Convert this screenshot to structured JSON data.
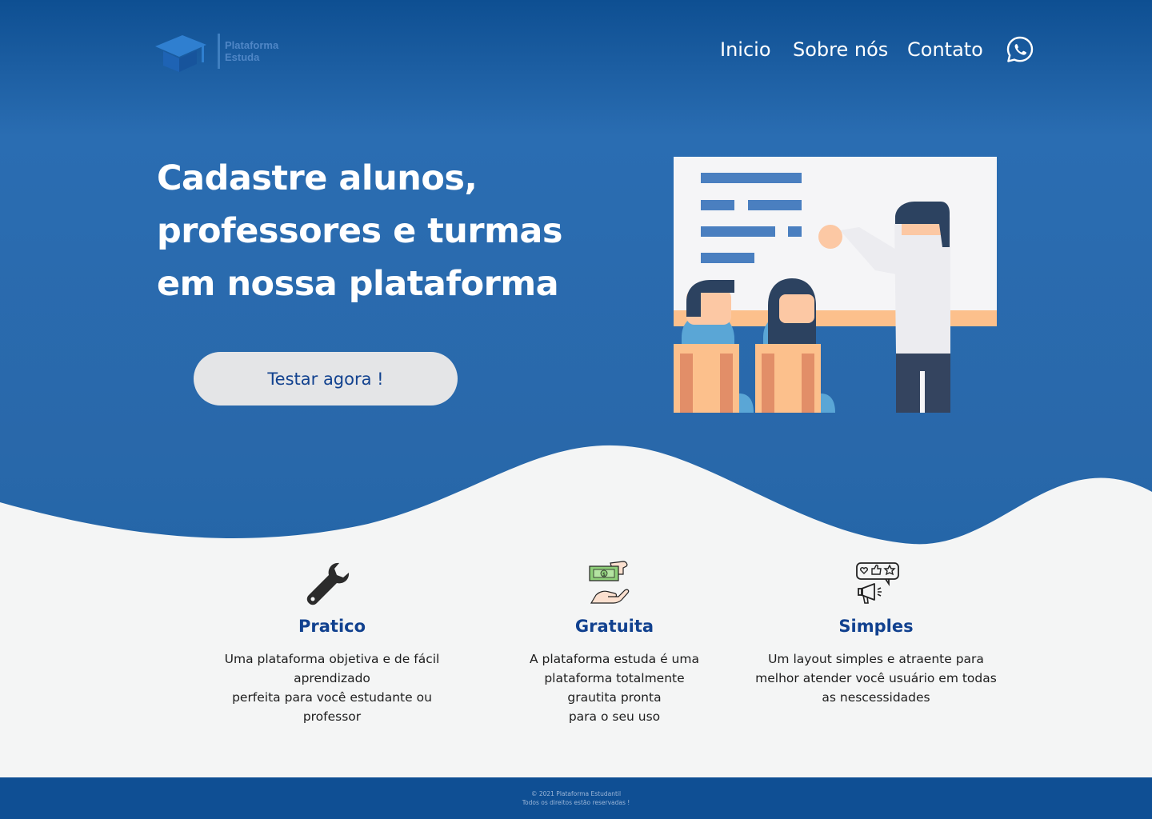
{
  "colors": {
    "hero_blue": "#2a6db2",
    "header_blue": "#0e4f92",
    "accent_navy": "#11418f",
    "button_bg": "#e4e5e7",
    "page_bg": "#f4f5f5",
    "footer_bg": "#0f4f94"
  },
  "header": {
    "logo": {
      "line1": "Plataforma",
      "line2": "Estuda",
      "icon": "graduation-cap-icon"
    },
    "nav": [
      "Inicio",
      "Sobre nós",
      "Contato"
    ],
    "contact_icon": "whatsapp-icon"
  },
  "hero": {
    "headline": [
      "Cadastre alunos,",
      "professores e turmas",
      "em nossa plataforma"
    ],
    "cta_label": "Testar agora !",
    "illustration": "classroom-teacher-illustration"
  },
  "features": [
    {
      "icon": "wrench-icon",
      "title": "Pratico",
      "lines": [
        "Uma plataforma objetiva e de fácil",
        "aprendizado",
        "perfeita para você estudante ou",
        "professor"
      ]
    },
    {
      "icon": "money-hand-icon",
      "title": "Gratuita",
      "lines": [
        "A plataforma estuda é uma",
        "plataforma totalmente",
        "grautita pronta",
        "para o seu uso"
      ]
    },
    {
      "icon": "feedback-megaphone-icon",
      "title": "Simples",
      "lines": [
        "Um layout simples e atraente para",
        "melhor atender você usuário em todas",
        "as nescessidades"
      ]
    }
  ],
  "footer": {
    "copyright": "© 2021 Plataforma Estudantil",
    "rights": "Todos os direitos estão reservadas !"
  }
}
